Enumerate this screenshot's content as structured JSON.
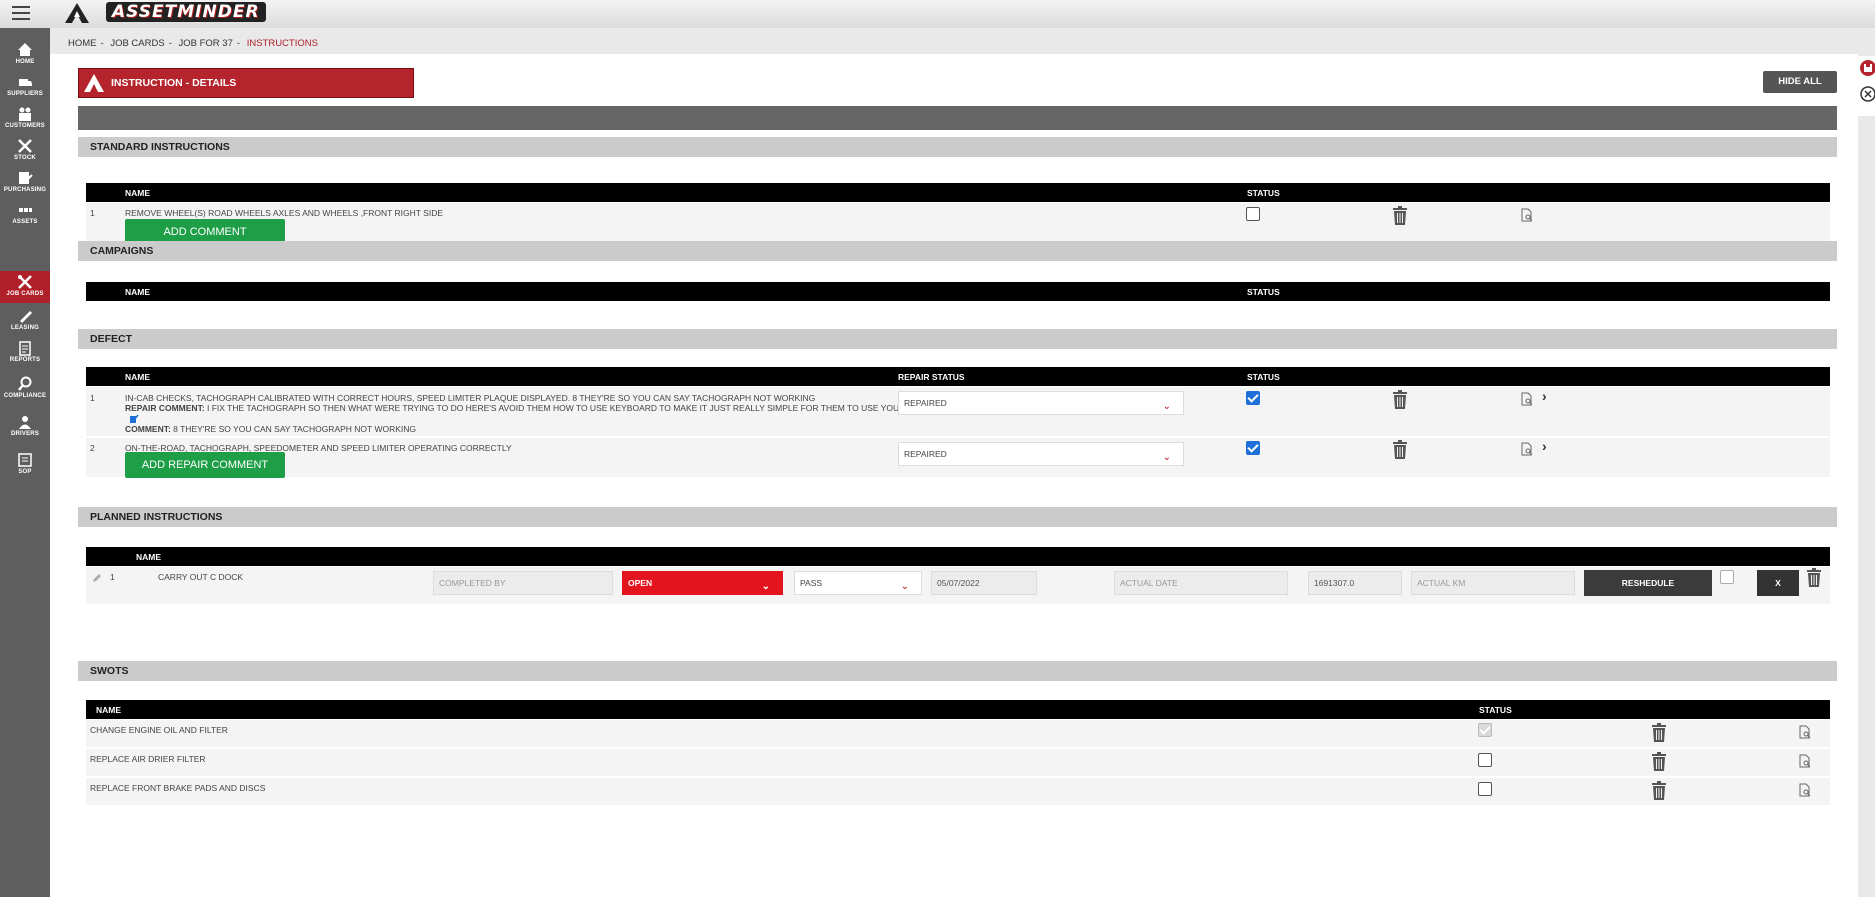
{
  "app": {
    "logo_text": "ASSETMINDER"
  },
  "topbar_icons": [
    "home-icon",
    "gear-icon",
    "truck-icon"
  ],
  "sidebar": {
    "items": [
      {
        "label": "HOME",
        "icon": "home-icon"
      },
      {
        "label": "SUPPLIERS",
        "icon": "suppliers-icon"
      },
      {
        "label": "CUSTOMERS",
        "icon": "customers-icon"
      },
      {
        "label": "STOCK",
        "icon": "stock-icon"
      },
      {
        "label": "PURCHASING",
        "icon": "purchasing-icon"
      },
      {
        "label": "ASSETS",
        "icon": "assets-icon"
      },
      {
        "label": "JOB CARDS",
        "icon": "job-cards-icon",
        "active": true
      },
      {
        "label": "LEASING",
        "icon": "leasing-icon"
      },
      {
        "label": "REPORTS",
        "icon": "reports-icon"
      },
      {
        "label": "COMPLIANCE",
        "icon": "compliance-icon"
      },
      {
        "label": "DRIVERS",
        "icon": "drivers-icon"
      },
      {
        "label": "SOP",
        "icon": "sop-icon"
      }
    ]
  },
  "breadcrumb": {
    "home": "HOME",
    "job_cards": "JOB CARDS",
    "job": "JOB FOR 37",
    "current": "INSTRUCTIONS"
  },
  "header": {
    "title": "INSTRUCTION - DETAILS",
    "hide_all": "HIDE ALL"
  },
  "standard": {
    "title": "STANDARD INSTRUCTIONS",
    "col_name": "NAME",
    "col_status": "STATUS",
    "rows": [
      {
        "num": "1",
        "name": "REMOVE WHEEL(S) ROAD WHEELS AXLES AND WHEELS ,FRONT RIGHT SIDE",
        "button": "ADD COMMENT",
        "checked": false
      }
    ]
  },
  "campaigns": {
    "title": "CAMPAIGNS",
    "col_name": "NAME",
    "col_status": "STATUS"
  },
  "defect": {
    "title": "DEFECT",
    "col_name": "NAME",
    "col_repair_status": "REPAIR STATUS",
    "col_status": "STATUS",
    "rows": [
      {
        "num": "1",
        "name": "IN-CAB CHECKS, TACHOGRAPH CALIBRATED WITH CORRECT HOURS, SPEED LIMITER PLAQUE DISPLAYED. 8 THEY'RE SO YOU CAN SAY TACHOGRAPH NOT WORKING",
        "repair_comment_label": "REPAIR COMMENT:",
        "repair_comment": " I FIX THE TACHOGRAPH SO THEN WHAT WERE TRYING TO DO HERE'S AVOID THEM HOW TO USE KEYBOARD TO MAKE IT JUST REALLY SIMPLE FOR THEM TO USE YOU CAN SEE IT'S PICKING UP EVERYTHING",
        "comment_label": "COMMENT:",
        "comment": " 8 THEY'RE SO YOU CAN SAY TACHOGRAPH NOT WORKING",
        "repair_status": "REPAIRED",
        "checked": true
      },
      {
        "num": "2",
        "name": "ON-THE-ROAD, TACHOGRAPH, SPEEDOMETER AND SPEED LIMITER OPERATING CORRECTLY",
        "button": "ADD REPAIR COMMENT",
        "repair_status": "REPAIRED",
        "checked": true
      }
    ]
  },
  "planned": {
    "title": "PLANNED INSTRUCTIONS",
    "col_name": "NAME",
    "row": {
      "num": "1",
      "name": "CARRY OUT C DOCK",
      "completed_by_placeholder": "COMPLETED BY",
      "status": "OPEN",
      "result": "PASS",
      "date": "05/07/2022",
      "actual_date_placeholder": "ACTUAL DATE",
      "km": "1691307.0",
      "actual_km_placeholder": "ACTUAL KM",
      "reschedule": "RESHEDULE",
      "close": "X"
    }
  },
  "swots": {
    "title": "SWOTS",
    "col_name": "NAME",
    "col_status": "STATUS",
    "rows": [
      {
        "name": "CHANGE ENGINE OIL AND FILTER",
        "state": "disabled-checked"
      },
      {
        "name": "REPLACE AIR DRIER FILTER",
        "state": "unchecked"
      },
      {
        "name": "REPLACE FRONT BRAKE PADS AND DISCS",
        "state": "unchecked"
      }
    ]
  },
  "colors": {
    "brand_red": "#b5242c",
    "sidebar": "#5e5e5e",
    "green": "#1e9e46",
    "status_red": "#e3141e"
  }
}
